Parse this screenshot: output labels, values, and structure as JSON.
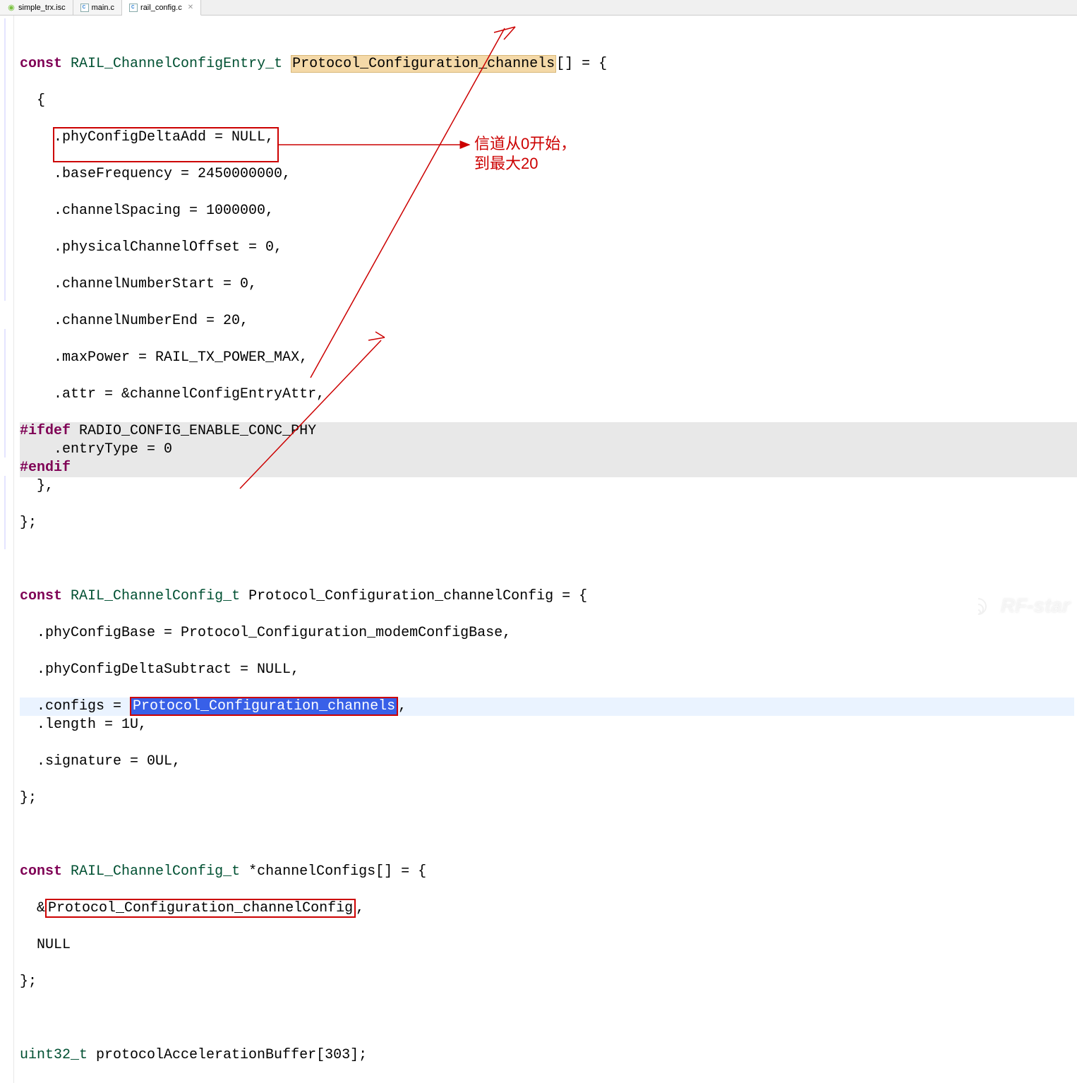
{
  "tabs": [
    {
      "label": "simple_trx.isc",
      "icon": "isc",
      "active": false
    },
    {
      "label": "main.c",
      "icon": "c",
      "active": false
    },
    {
      "label": "rail_config.c",
      "icon": "c",
      "active": true
    }
  ],
  "code": {
    "l1_kw": "const",
    "l1_type": "RAIL_ChannelConfigEntry_t",
    "l1_name": "Protocol_Configuration_channels",
    "l1_suffix": "[] = {",
    "l2": "  {",
    "l3": "    .phyConfigDeltaAdd = NULL,",
    "l4": "    .baseFrequency = 2450000000,",
    "l5": "    .channelSpacing = 1000000,",
    "l6": "    .physicalChannelOffset = 0,",
    "l7": "    .channelNumberStart = 0,",
    "l8": "    .channelNumberEnd = 20,",
    "l9": "    .maxPower = RAIL_TX_POWER_MAX,",
    "l10": "    .attr = &channelConfigEntryAttr,",
    "l11_pp": "#ifdef",
    "l11_sym": " RADIO_CONFIG_ENABLE_CONC_PHY",
    "l12": "    .entryType = 0",
    "l13_pp": "#endif",
    "l14": "  },",
    "l15": "};",
    "l17_kw": "const",
    "l17_type": "RAIL_ChannelConfig_t",
    "l17_name": " Protocol_Configuration_channelConfig = {",
    "l18": "  .phyConfigBase = Protocol_Configuration_modemConfigBase,",
    "l19": "  .phyConfigDeltaSubtract = NULL,",
    "l20_pre": "  .configs = ",
    "l20_hl": "Protocol_Configuration_channels",
    "l20_post": ",",
    "l21": "  .length = 1U,",
    "l22": "  .signature = 0UL,",
    "l23": "};",
    "l25_kw": "const",
    "l25_type": "RAIL_ChannelConfig_t",
    "l25_rest": " *channelConfigs[] = {",
    "l26_pre": "  &",
    "l26_hl": "Protocol_Configuration_channelConfig",
    "l26_post": ",",
    "l27": "  NULL",
    "l28": "};",
    "l30_type": "uint32_t",
    "l30_rest": " protocolAccelerationBuffer[303];"
  },
  "annotation": {
    "line1": "信道从0开始，",
    "line2": "到最大20"
  },
  "watermark": "RF-star"
}
